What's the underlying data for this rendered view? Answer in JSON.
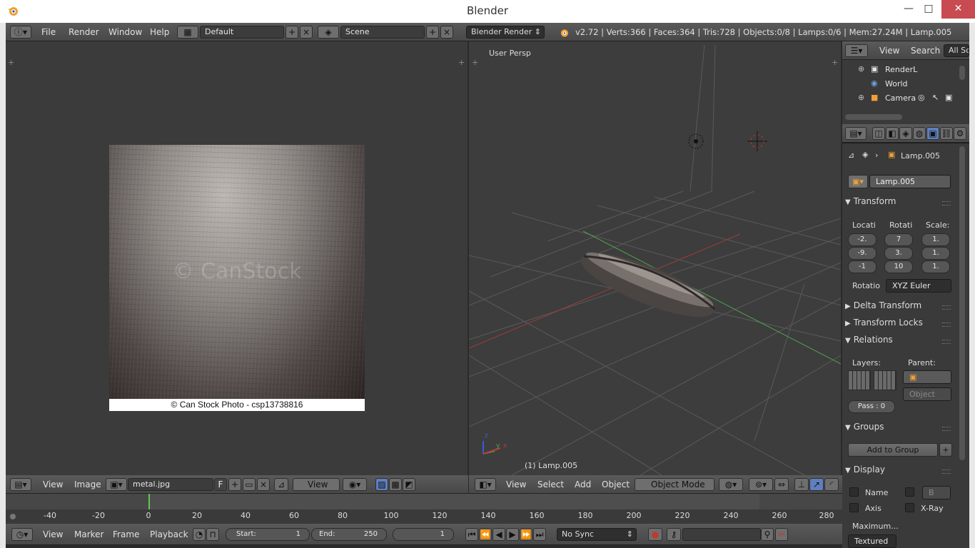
{
  "window": {
    "title": "Blender",
    "minimize": "—",
    "maximize": "□",
    "close": "✕"
  },
  "info_header": {
    "menus": [
      "File",
      "Render",
      "Window",
      "Help"
    ],
    "layout": "Default",
    "scene": "Scene",
    "engine": "Blender Render",
    "stats": "v2.72 | Verts:366 | Faces:364 | Tris:728 | Objects:0/8 | Lamps:0/6 | Mem:27.24M | Lamp.005"
  },
  "image_editor": {
    "watermark": "© CanStock",
    "credit": "© Can Stock Photo - csp13738816",
    "header": {
      "view": "View",
      "image": "Image",
      "image_name": "metal.jpg",
      "fake_user": "F",
      "view_mode": "View"
    }
  },
  "viewport": {
    "label": "User Persp",
    "object_label": "(1) Lamp.005",
    "header": {
      "view": "View",
      "select": "Select",
      "add": "Add",
      "object": "Object",
      "mode": "Object Mode"
    },
    "axes": {
      "z": "z",
      "y": "y",
      "x": "x"
    }
  },
  "outliner": {
    "header": {
      "view": "View",
      "search": "Search",
      "filter": "All Sc"
    },
    "items": [
      "RenderL",
      "World",
      "Camera"
    ]
  },
  "properties": {
    "breadcrumb": "Lamp.005",
    "object_name": "Lamp.005",
    "transform": {
      "title": "Transform",
      "loc_label": "Locati",
      "rot_label": "Rotati",
      "scale_label": "Scale:",
      "loc": [
        "-2.",
        "-9.",
        "-1"
      ],
      "rot": [
        "7",
        "3.",
        "10"
      ],
      "scale": [
        "1.",
        "1.",
        "1."
      ],
      "rotation_mode_label": "Rotatio",
      "rotation_mode": "XYZ Euler"
    },
    "delta_transform": "Delta Transform",
    "transform_locks": "Transform Locks",
    "relations": {
      "title": "Relations",
      "layers_label": "Layers:",
      "parent_label": "Parent:",
      "parent_type": "Object",
      "pass": "Pass : 0"
    },
    "groups": {
      "title": "Groups",
      "add_to_group": "Add to Group"
    },
    "display": {
      "title": "Display",
      "name": "Name",
      "bounds": "B",
      "axis": "Axis",
      "xray": "X-Ray",
      "maximum": "Maximum...",
      "textured": "Textured"
    }
  },
  "timeline": {
    "ticks": [
      "-40",
      "-20",
      "0",
      "20",
      "40",
      "60",
      "80",
      "100",
      "120",
      "140",
      "160",
      "180",
      "200",
      "220",
      "240",
      "260",
      "280"
    ],
    "header": {
      "view": "View",
      "marker": "Marker",
      "frame": "Frame",
      "playback": "Playback",
      "start_label": "Start:",
      "start": "1",
      "end_label": "End:",
      "end": "250",
      "current": "1",
      "sync": "No Sync"
    }
  },
  "colors": {
    "accent_orange": "#f0a035",
    "grid_red": "#a33a3a",
    "grid_green": "#4da34d",
    "close_red": "#c74b50"
  }
}
